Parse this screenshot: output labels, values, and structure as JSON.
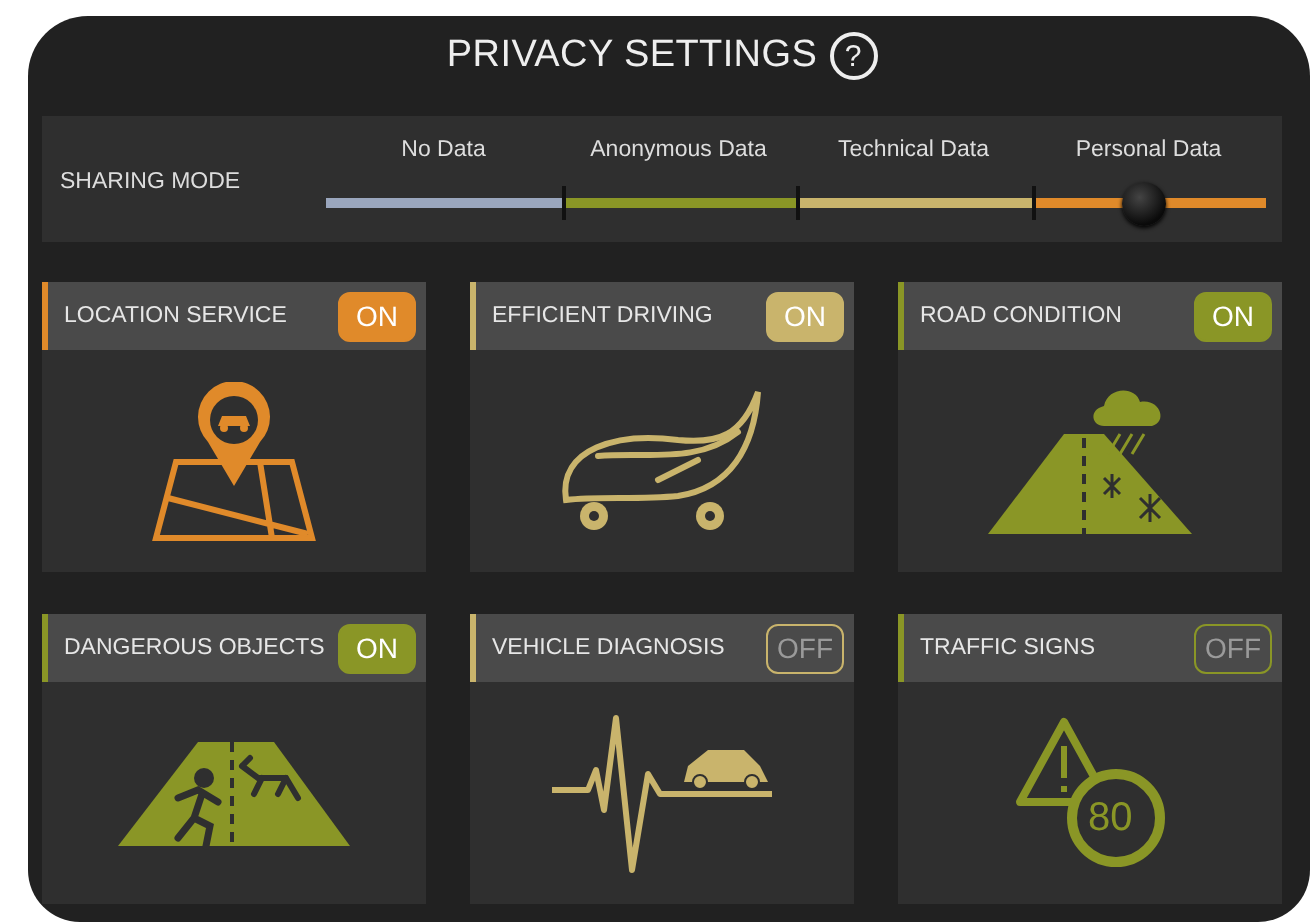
{
  "title": "PRIVACY SETTINGS",
  "help_icon": "?",
  "sharing_mode": {
    "label": "SHARING MODE",
    "level": 0.87,
    "options": [
      {
        "label": "No Data",
        "color": "#9aa6bd"
      },
      {
        "label": "Anonymous Data",
        "color": "#8a9626"
      },
      {
        "label": "Technical Data",
        "color": "#c9b46c"
      },
      {
        "label": "Personal Data",
        "color": "#e08a2a"
      }
    ]
  },
  "cards": [
    {
      "title": "LOCATION SERVICE",
      "toggle": "ON",
      "on": true,
      "color": "#e08a2a",
      "kind": "map"
    },
    {
      "title": "EFFICIENT DRIVING",
      "toggle": "ON",
      "on": true,
      "color": "#c9b46c",
      "kind": "leaf"
    },
    {
      "title": "ROAD CONDITION",
      "toggle": "ON",
      "on": true,
      "color": "#8a9626",
      "kind": "weather"
    },
    {
      "title": "DANGEROUS OBJECTS",
      "toggle": "ON",
      "on": true,
      "color": "#8a9626",
      "kind": "hazard"
    },
    {
      "title": "VEHICLE DIAGNOSIS",
      "toggle": "OFF",
      "on": false,
      "color": "#c9b46c",
      "kind": "pulse"
    },
    {
      "title": "TRAFFIC SIGNS",
      "toggle": "OFF",
      "on": false,
      "color": "#8a9626",
      "kind": "sign",
      "sign_text": "80"
    }
  ]
}
